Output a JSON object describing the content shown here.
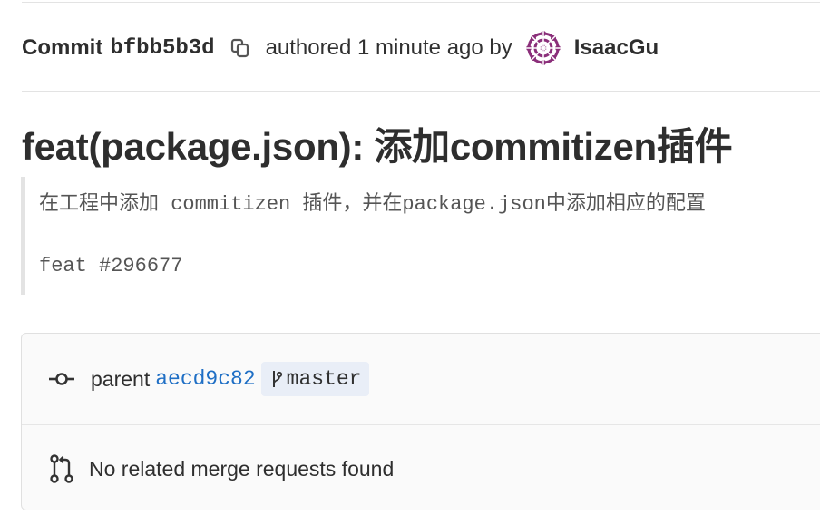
{
  "commit": {
    "label": "Commit",
    "sha": "bfbb5b3d",
    "authored_text": "authored 1 minute ago by",
    "author": "IsaacGu"
  },
  "title": "feat(package.json): 添加commitizen插件",
  "description": {
    "line1": "在工程中添加 commitizen 插件，并在package.json中添加相应的配置",
    "line2": "feat #296677"
  },
  "info": {
    "parent_label": "parent",
    "parent_sha": "aecd9c82",
    "branch": "master",
    "merge_requests_text": "No related merge requests found"
  },
  "colors": {
    "link": "#1f6fc5",
    "avatar": "#8b2f7a",
    "branch_badge_bg": "#e9eef7"
  },
  "icons": [
    "copy-icon",
    "avatar-identicon",
    "commit-icon",
    "branch-icon",
    "merge-request-icon"
  ]
}
